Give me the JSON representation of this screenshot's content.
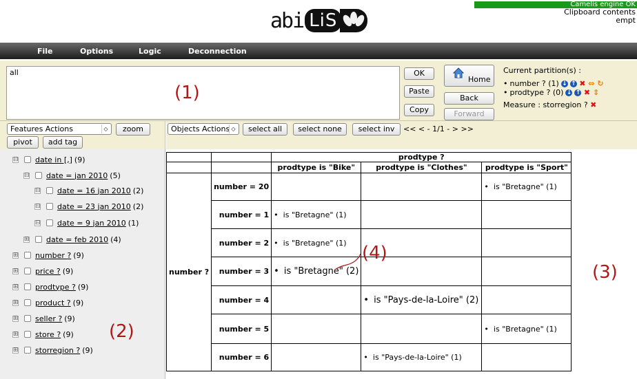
{
  "header": {
    "logo_text_1": "abi",
    "logo_text_2": "LiS",
    "engine_status": "Camelis engine OK",
    "clipboard_line1": "Clipboard contents",
    "clipboard_line2": "empt"
  },
  "menu": [
    "File",
    "Options",
    "Logic",
    "Deconnection"
  ],
  "query": {
    "value": "all",
    "ok_label": "OK",
    "paste_label": "Paste",
    "copy_label": "Copy",
    "home_label": "Home",
    "back_label": "Back",
    "forward_label": "Forward"
  },
  "partition": {
    "title": "Current partition(s) :",
    "items": [
      {
        "label": "number ? (1)"
      },
      {
        "label": "prodtype ? (0)"
      }
    ],
    "measure": "Measure : storregion ?"
  },
  "features_bar": {
    "select_value": "Features Actions",
    "zoom_label": "zoom",
    "pivot_label": "pivot",
    "add_tag_label": "add tag"
  },
  "objects_bar": {
    "select_value": "Objects Actions",
    "select_all_label": "select all",
    "select_none_label": "select none",
    "select_inv_label": "select inv",
    "pager": "<< < - 1/1 - > >>"
  },
  "features": [
    {
      "toggle": "⊟",
      "label": "date in [,]",
      "count": "(9)"
    },
    {
      "toggle": "⊟",
      "label": "date = jan 2010",
      "count": "(5)"
    },
    {
      "toggle": "⊟",
      "label": "date = 16 jan 2010",
      "count": "(2)"
    },
    {
      "toggle": "⊟",
      "label": "date = 23 jan 2010",
      "count": "(2)"
    },
    {
      "toggle": "⊟",
      "label": "date = 9 jan 2010",
      "count": "(1)"
    },
    {
      "toggle": "⊞",
      "label": "date = feb 2010",
      "count": "(4)"
    },
    {
      "toggle": "⊞",
      "label": "number ?",
      "count": "(9)"
    },
    {
      "toggle": "⊞",
      "label": "price ?",
      "count": "(9)"
    },
    {
      "toggle": "⊞",
      "label": "prodtype ?",
      "count": "(9)"
    },
    {
      "toggle": "⊞",
      "label": "product ?",
      "count": "(9)"
    },
    {
      "toggle": "⊞",
      "label": "seller ?",
      "count": "(9)"
    },
    {
      "toggle": "⊞",
      "label": "store ?",
      "count": "(9)"
    },
    {
      "toggle": "⊞",
      "label": "storregion ?",
      "count": "(9)"
    }
  ],
  "table": {
    "col_group": "prodtype ?",
    "cols": [
      "prodtype is \"Bike\"",
      "prodtype is \"Clothes\"",
      "prodtype is \"Sport\""
    ],
    "row_group": "number ?",
    "rows": [
      {
        "label": "number = 20",
        "cells": [
          "",
          "",
          "is \"Bretagne\" (1)"
        ]
      },
      {
        "label": "number = 1",
        "cells": [
          "is \"Bretagne\" (1)",
          "",
          ""
        ]
      },
      {
        "label": "number = 2",
        "cells": [
          "is \"Bretagne\" (1)",
          "",
          ""
        ]
      },
      {
        "label": "number = 3",
        "cells": [
          "is \"Bretagne\" (2)",
          "",
          ""
        ]
      },
      {
        "label": "number = 4",
        "cells": [
          "",
          "is \"Pays-de-la-Loire\" (2)",
          ""
        ]
      },
      {
        "label": "number = 5",
        "cells": [
          "",
          "",
          "is \"Bretagne\" (1)"
        ]
      },
      {
        "label": "number = 6",
        "cells": [
          "",
          "is \"Pays-de-la-Loire\" (1)",
          ""
        ]
      }
    ]
  },
  "annotations": {
    "a1": "(1)",
    "a2": "(2)",
    "a3": "(3)",
    "a4": "(4)"
  },
  "colors": {
    "toolbar_bg": "#f2efd5",
    "engine_ok": "#1a9a1a",
    "annotation": "#b01818"
  }
}
